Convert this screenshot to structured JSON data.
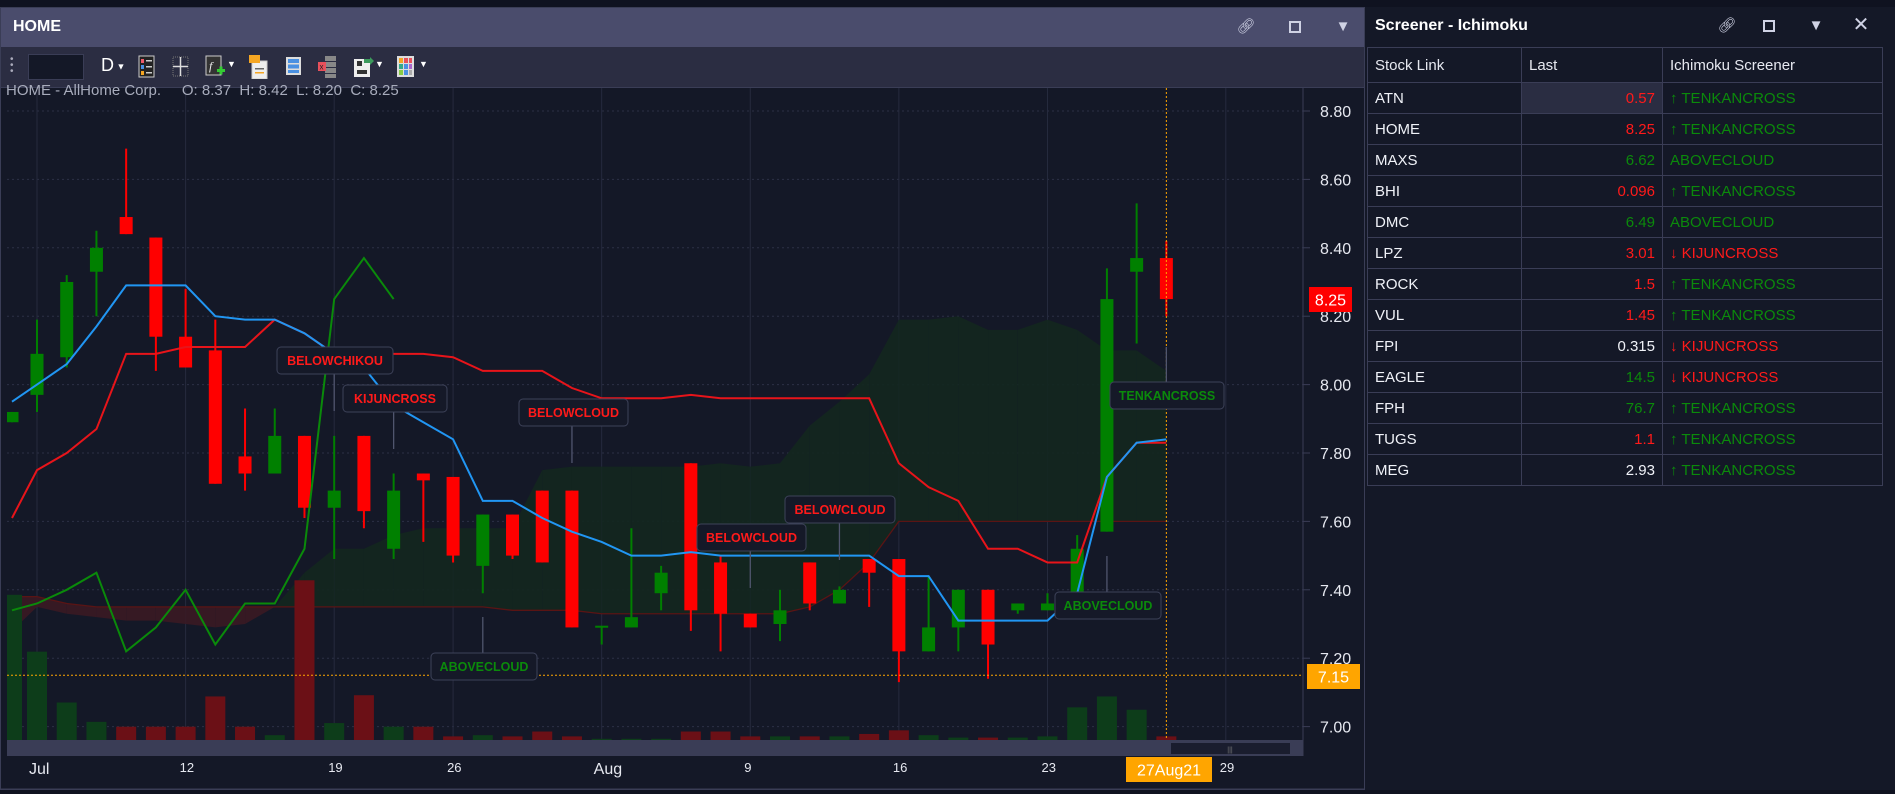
{
  "chart_window": {
    "title": "HOME",
    "toolbar": {
      "symbol_input": "",
      "interval": "D"
    },
    "info": {
      "name": "HOME - AllHome Corp.",
      "ohlc": "O: 8.37  H: 8.42  L: 8.20  C: 8.25"
    },
    "last_price_tag": "8.25",
    "crosshair_price_tag": "7.15",
    "crosshair_date_tag": "27Aug21"
  },
  "chart_data": {
    "type": "candlestick",
    "ylim": [
      7.0,
      8.8
    ],
    "y_ticks": [
      "7.00",
      "7.20",
      "7.40",
      "7.60",
      "7.80",
      "8.00",
      "8.20",
      "8.40",
      "8.60",
      "8.80"
    ],
    "y_tick_values": [
      7.0,
      7.2,
      7.4,
      7.6,
      7.8,
      8.0,
      8.2,
      8.4,
      8.6,
      8.8
    ],
    "x_ticks": [
      {
        "label": "Jul",
        "date": "Jul 5"
      },
      {
        "label": "12",
        "date": "Jul 12"
      },
      {
        "label": "19",
        "date": "Jul 19"
      },
      {
        "label": "26",
        "date": "Jul 26"
      },
      {
        "label": "Aug",
        "date": "Aug 2"
      },
      {
        "label": "9",
        "date": "Aug 9"
      },
      {
        "label": "16",
        "date": "Aug 16"
      },
      {
        "label": "23",
        "date": "Aug 23"
      },
      {
        "label": "29",
        "date": "Aug 29"
      }
    ],
    "future_dates": [
      "Aug 28",
      "Aug 29"
    ],
    "fields": [
      "date",
      "open",
      "high",
      "low",
      "close",
      "volume_relative"
    ],
    "candles": [
      [
        "Jul 2",
        7.89,
        7.92,
        7.89,
        7.92,
        120
      ],
      [
        "Jul 5",
        7.97,
        8.19,
        7.92,
        8.09,
        73
      ],
      [
        "Jul 6",
        8.08,
        8.32,
        8.05,
        8.3,
        31
      ],
      [
        "Jul 7",
        8.33,
        8.45,
        8.2,
        8.4,
        15
      ],
      [
        "Jul 8",
        8.49,
        8.69,
        8.44,
        8.44,
        11
      ],
      [
        "Jul 9",
        8.43,
        8.43,
        8.04,
        8.14,
        11
      ],
      [
        "Jul 12",
        8.14,
        8.28,
        8.05,
        8.05,
        11
      ],
      [
        "Jul 13",
        8.1,
        8.19,
        7.71,
        7.71,
        36
      ],
      [
        "Jul 14",
        7.79,
        7.93,
        7.69,
        7.74,
        11
      ],
      [
        "Jul 15",
        7.74,
        7.93,
        7.74,
        7.85,
        4
      ],
      [
        "Jul 16",
        7.85,
        7.85,
        7.61,
        7.64,
        132
      ],
      [
        "Jul 19",
        7.64,
        7.85,
        7.49,
        7.69,
        14
      ],
      [
        "Jul 21",
        7.85,
        7.85,
        7.58,
        7.63,
        37
      ],
      [
        "Jul 22",
        7.52,
        7.74,
        7.49,
        7.69,
        11
      ],
      [
        "Jul 23",
        7.74,
        7.74,
        7.54,
        7.72,
        11
      ],
      [
        "Jul 26",
        7.73,
        7.73,
        7.48,
        7.5,
        3
      ],
      [
        "Jul 27",
        7.47,
        7.62,
        7.39,
        7.62,
        4
      ],
      [
        "Jul 28",
        7.62,
        7.62,
        7.49,
        7.5,
        3
      ],
      [
        "Jul 29",
        7.69,
        7.69,
        7.48,
        7.48,
        7
      ],
      [
        "Jul 30",
        7.69,
        7.69,
        7.29,
        7.29,
        3
      ],
      [
        "Aug 2",
        7.29,
        7.29,
        7.24,
        7.295,
        1
      ],
      [
        "Aug 3",
        7.29,
        7.58,
        7.29,
        7.32,
        1
      ],
      [
        "Aug 4",
        7.39,
        7.47,
        7.34,
        7.45,
        1
      ],
      [
        "Aug 5",
        7.77,
        7.77,
        7.28,
        7.34,
        7
      ],
      [
        "Aug 6",
        7.48,
        7.5,
        7.22,
        7.33,
        7
      ],
      [
        "Aug 9",
        7.33,
        7.33,
        7.29,
        7.29,
        3
      ],
      [
        "Aug 10",
        7.3,
        7.4,
        7.25,
        7.34,
        3
      ],
      [
        "Aug 11",
        7.48,
        7.48,
        7.34,
        7.36,
        3
      ],
      [
        "Aug 12",
        7.36,
        7.41,
        7.36,
        7.4,
        3
      ],
      [
        "Aug 13",
        7.49,
        7.49,
        7.35,
        7.45,
        5
      ],
      [
        "Aug 16",
        7.49,
        7.49,
        7.13,
        7.22,
        8
      ],
      [
        "Aug 17",
        7.22,
        7.44,
        7.22,
        7.29,
        4
      ],
      [
        "Aug 18",
        7.29,
        7.4,
        7.22,
        7.4,
        2
      ],
      [
        "Aug 19",
        7.4,
        7.4,
        7.14,
        7.24,
        2
      ],
      [
        "Aug 20",
        7.34,
        7.36,
        7.33,
        7.36,
        2
      ],
      [
        "Aug 23",
        7.34,
        7.39,
        7.34,
        7.36,
        3
      ],
      [
        "Aug 24",
        7.39,
        7.56,
        7.39,
        7.52,
        27
      ],
      [
        "Aug 25",
        7.57,
        8.34,
        7.57,
        8.25,
        36
      ],
      [
        "Aug 26",
        8.33,
        8.53,
        8.12,
        8.37,
        25
      ],
      [
        "Aug 27",
        8.37,
        8.42,
        8.2,
        8.25,
        3
      ]
    ],
    "tenkan": [
      7.95,
      8.0,
      8.06,
      8.17,
      8.29,
      8.29,
      8.29,
      8.2,
      8.19,
      8.19,
      8.15,
      8.09,
      8.05,
      7.94,
      7.89,
      7.84,
      7.66,
      7.66,
      7.61,
      7.57,
      7.54,
      7.5,
      7.5,
      7.51,
      7.5,
      7.5,
      7.5,
      7.5,
      7.5,
      7.5,
      7.44,
      7.44,
      7.31,
      7.31,
      7.31,
      7.31,
      7.39,
      7.73,
      7.83,
      7.84
    ],
    "kijun": [
      7.61,
      7.75,
      7.8,
      7.87,
      8.09,
      8.09,
      8.11,
      8.11,
      8.11,
      8.19,
      8.15,
      8.09,
      8.09,
      8.09,
      8.09,
      8.08,
      8.04,
      8.04,
      8.04,
      7.99,
      7.96,
      7.96,
      7.96,
      7.97,
      7.96,
      7.96,
      7.96,
      7.96,
      7.96,
      7.96,
      7.77,
      7.7,
      7.66,
      7.52,
      7.52,
      7.48,
      7.48,
      7.73,
      7.83,
      7.83
    ],
    "chikou": [
      7.34,
      7.36,
      7.4,
      7.45,
      7.22,
      7.29,
      7.4,
      7.24,
      7.36,
      7.36,
      7.52,
      8.25,
      8.37,
      8.25
    ],
    "senkou_a": [
      7.28,
      7.35,
      7.33,
      7.32,
      7.31,
      7.31,
      7.3,
      7.29,
      7.3,
      7.35,
      7.45,
      7.52,
      7.52,
      7.56,
      7.58,
      7.58,
      7.58,
      7.58,
      7.75,
      7.76,
      7.76,
      7.76,
      7.76,
      7.76,
      7.77,
      7.76,
      7.77,
      7.88,
      7.95,
      8.03,
      8.19,
      8.19,
      8.2,
      8.16,
      8.16,
      8.19,
      8.16,
      8.1,
      8.1,
      8.04
    ],
    "senkou_b": [
      7.38,
      7.38,
      7.36,
      7.35,
      7.35,
      7.35,
      7.35,
      7.35,
      7.35,
      7.35,
      7.35,
      7.35,
      7.35,
      7.35,
      7.35,
      7.35,
      7.35,
      7.34,
      7.34,
      7.34,
      7.33,
      7.33,
      7.33,
      7.33,
      7.33,
      7.33,
      7.33,
      7.35,
      7.4,
      7.48,
      7.6,
      7.6,
      7.6,
      7.6,
      7.6,
      7.6,
      7.6,
      7.6,
      7.6,
      7.6
    ],
    "crosshair": {
      "date": "Aug 27",
      "price": 7.15
    },
    "annotations": [
      {
        "text": "BELOWCHIKOU",
        "date": "Jul 19",
        "signal": "bearish"
      },
      {
        "text": "KIJUNCROSS",
        "date": "Jul 22",
        "signal": "bearish"
      },
      {
        "text": "BELOWCLOUD",
        "date": "Jul 30",
        "signal": "bearish"
      },
      {
        "text": "ABOVECLOUD",
        "date": "Jul 27",
        "signal": "bullish"
      },
      {
        "text": "BELOWCLOUD",
        "date": "Aug 9",
        "signal": "bearish"
      },
      {
        "text": "BELOWCLOUD",
        "date": "Aug 12",
        "signal": "bearish"
      },
      {
        "text": "ABOVECLOUD",
        "date": "Aug 25",
        "signal": "bullish"
      },
      {
        "text": "TENKANCROSS",
        "date": "Aug 27",
        "signal": "bullish"
      }
    ],
    "colors": {
      "up": "#008000",
      "down": "#ff0000",
      "tenkan": "#2196f3",
      "kijun": "#e8141a",
      "chikou": "#0a8a0a",
      "cloud_bull": "#13271f",
      "cloud_bear": "#3a1a24",
      "crosshair": "#ffa500"
    }
  },
  "screener": {
    "title": "Screener - Ichimoku",
    "columns": [
      "Stock Link",
      "Last",
      "Ichimoku Screener"
    ],
    "rows": [
      {
        "stock": "ATN",
        "last": "0.57",
        "last_color": "red",
        "signal": "↑ TENKANCROSS",
        "signal_color": "green"
      },
      {
        "stock": "HOME",
        "last": "8.25",
        "last_color": "red",
        "signal": "↑ TENKANCROSS",
        "signal_color": "green"
      },
      {
        "stock": "MAXS",
        "last": "6.62",
        "last_color": "green",
        "signal": "ABOVECLOUD",
        "signal_color": "green"
      },
      {
        "stock": "BHI",
        "last": "0.096",
        "last_color": "red",
        "signal": "↑ TENKANCROSS",
        "signal_color": "green"
      },
      {
        "stock": "DMC",
        "last": "6.49",
        "last_color": "green",
        "signal": "ABOVECLOUD",
        "signal_color": "green"
      },
      {
        "stock": "LPZ",
        "last": "3.01",
        "last_color": "red",
        "signal": "↓ KIJUNCROSS",
        "signal_color": "red"
      },
      {
        "stock": "ROCK",
        "last": "1.5",
        "last_color": "red",
        "signal": "↑ TENKANCROSS",
        "signal_color": "green"
      },
      {
        "stock": "VUL",
        "last": "1.45",
        "last_color": "red",
        "signal": "↑ TENKANCROSS",
        "signal_color": "green"
      },
      {
        "stock": "FPI",
        "last": "0.315",
        "last_color": "white",
        "signal": "↓ KIJUNCROSS",
        "signal_color": "red"
      },
      {
        "stock": "EAGLE",
        "last": "14.5",
        "last_color": "green",
        "signal": "↓ KIJUNCROSS",
        "signal_color": "red"
      },
      {
        "stock": "FPH",
        "last": "76.7",
        "last_color": "green",
        "signal": "↑ TENKANCROSS",
        "signal_color": "green"
      },
      {
        "stock": "TUGS",
        "last": "1.1",
        "last_color": "red",
        "signal": "↑ TENKANCROSS",
        "signal_color": "green"
      },
      {
        "stock": "MEG",
        "last": "2.93",
        "last_color": "white",
        "signal": "↑ TENKANCROSS",
        "signal_color": "green"
      }
    ]
  },
  "icons": [
    "link-icon",
    "maximize-icon",
    "pin-icon",
    "close-icon",
    "drag-handle-icon",
    "legend-icon",
    "crosshair-icon",
    "indicator-fx-icon",
    "template-icon",
    "layout-icon",
    "delete-indicators-icon",
    "save-icon",
    "color-grid-icon"
  ]
}
